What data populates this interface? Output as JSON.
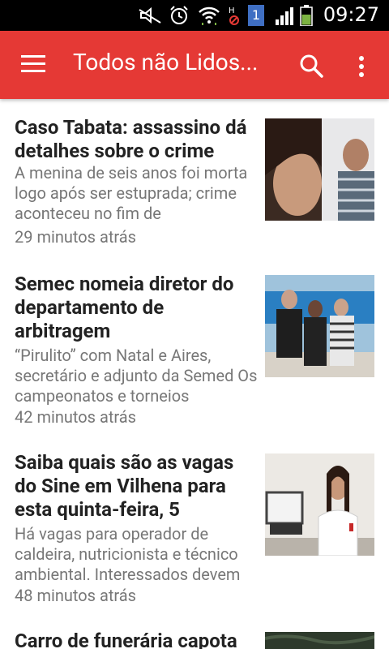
{
  "status_bar": {
    "time": "09:27",
    "battery_badge": "1"
  },
  "app_bar": {
    "title": "Todos não Lidos..."
  },
  "articles": [
    {
      "headline": "Caso Tabata: assassino dá detalhes sobre o crime",
      "snippet": "A menina de seis anos foi morta logo após ser estuprada; crime aconteceu no fim de",
      "time": "29 minutos atrás"
    },
    {
      "headline": "Semec nomeia diretor do departamento de arbitragem",
      "snippet": "“Pirulito” com Natal e Aires, secretário e adjunto da Semed Os campeonatos e torneios",
      "time": "42 minutos atrás"
    },
    {
      "headline": "Saiba quais são as vagas do Sine em Vilhena para esta quinta-feira, 5",
      "snippet": "Há vagas para operador de caldeira, nutricionista e técnico ambiental. Interessados devem",
      "time": "48 minutos atrás"
    },
    {
      "headline": "Carro de funerária capota",
      "snippet": "",
      "time": ""
    }
  ]
}
